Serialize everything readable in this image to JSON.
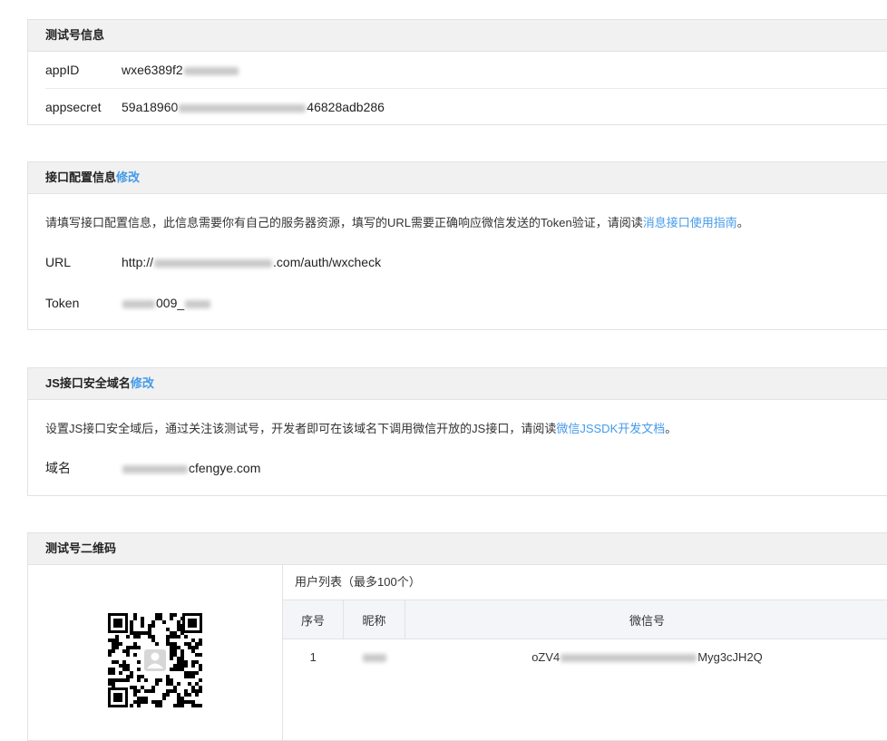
{
  "test_account": {
    "title": "测试号信息",
    "appid_label": "appID",
    "appid_prefix": "wxe6389f2",
    "appsecret_label": "appsecret",
    "appsecret_prefix": "59a18960",
    "appsecret_suffix": "46828adb286"
  },
  "interface_config": {
    "title": "接口配置信息",
    "edit_label": "修改",
    "desc_text": "请填写接口配置信息，此信息需要你有自己的服务器资源，填写的URL需要正确响应微信发送的Token验证，请阅读",
    "desc_link": "消息接口使用指南",
    "desc_end": "。",
    "url_label": "URL",
    "url_prefix": "http://",
    "url_suffix": ".com/auth/wxcheck",
    "token_label": "Token",
    "token_mid": "009_"
  },
  "js_domain": {
    "title": "JS接口安全域名",
    "edit_label": "修改",
    "desc_text": "设置JS接口安全域后，通过关注该测试号，开发者即可在该域名下调用微信开放的JS接口，请阅读",
    "desc_link": "微信JSSDK开发文档",
    "desc_end": "。",
    "domain_label": "域名",
    "domain_suffix": "cfengye.com"
  },
  "qrcode": {
    "title": "测试号二维码",
    "user_list_title": "用户列表（最多100个）",
    "columns": [
      "序号",
      "昵称",
      "微信号"
    ],
    "rows": [
      {
        "index": "1",
        "wechat_prefix": "oZV4",
        "wechat_suffix": "Myg3cJH2Q"
      }
    ]
  }
}
